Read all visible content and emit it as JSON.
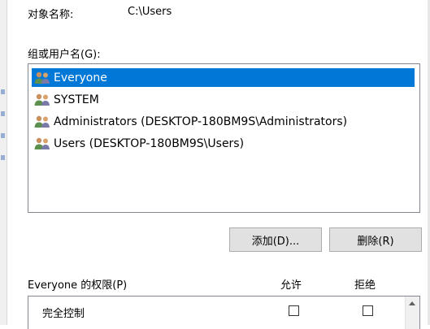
{
  "object": {
    "label": "对象名称:",
    "value": "C:\\Users"
  },
  "groups": {
    "label": "组或用户名(G):",
    "items": [
      {
        "label": "Everyone",
        "selected": true
      },
      {
        "label": "SYSTEM",
        "selected": false
      },
      {
        "label": "Administrators (DESKTOP-180BM9S\\Administrators)",
        "selected": false
      },
      {
        "label": "Users (DESKTOP-180BM9S\\Users)",
        "selected": false
      }
    ]
  },
  "buttons": {
    "add": "添加(D)...",
    "remove": "删除(R)"
  },
  "permissions": {
    "label": "Everyone 的权限(P)",
    "allow_header": "允许",
    "deny_header": "拒绝",
    "rows": [
      {
        "label": "完全控制",
        "allow": false,
        "deny": false
      }
    ]
  },
  "colors": {
    "selection": "#0078d7",
    "button": "#e1e1e1",
    "border": "#828790"
  },
  "icons": {
    "group": "users-group-icon",
    "scroll_up": "chevron-up-icon"
  }
}
